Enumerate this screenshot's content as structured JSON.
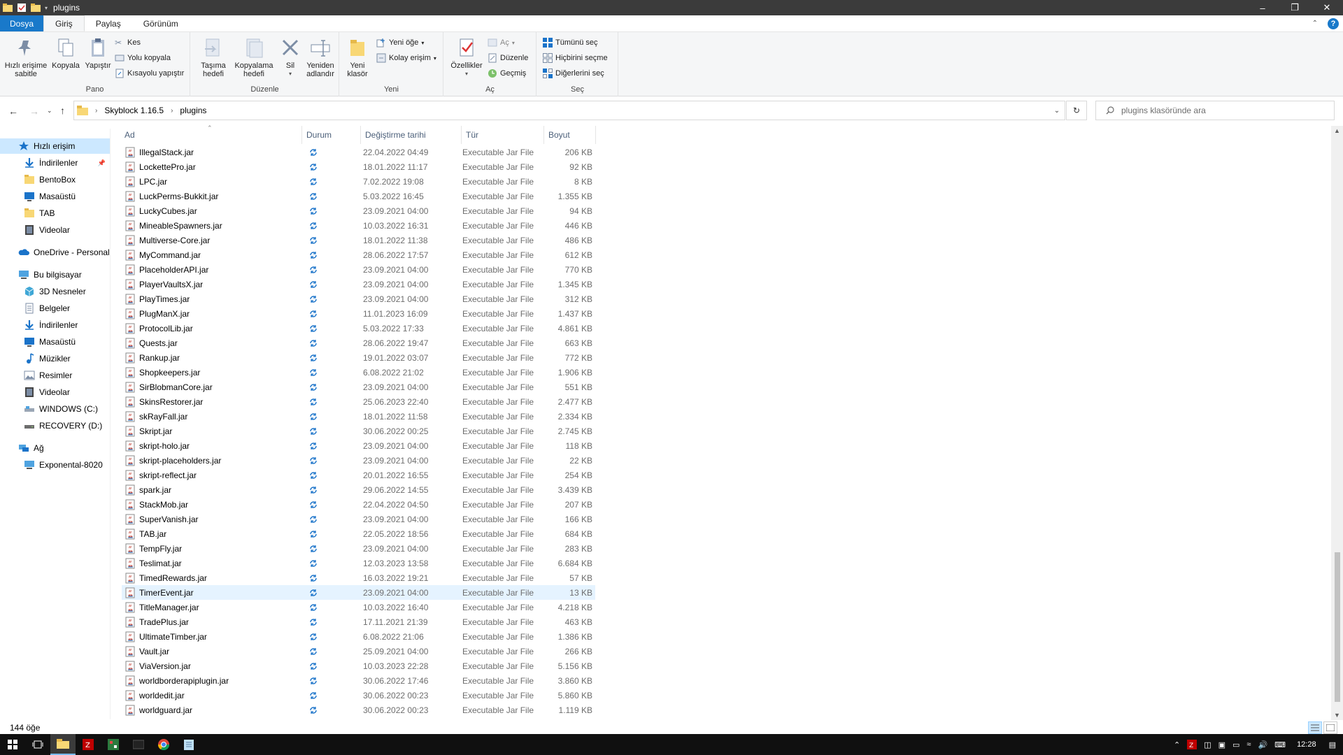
{
  "window": {
    "title": "plugins"
  },
  "ribbon_tabs": [
    "Dosya",
    "Giriş",
    "Paylaş",
    "Görünüm"
  ],
  "ribbon": {
    "pano": {
      "label": "Pano",
      "pin": "Hızlı erişime sabitle",
      "copy": "Kopyala",
      "paste": "Yapıştır",
      "cut": "Kes",
      "copy_path": "Yolu kopyala",
      "paste_shortcut": "Kısayolu yapıştır"
    },
    "duzenle": {
      "label": "Düzenle",
      "move_to": "Taşıma hedefi",
      "copy_to": "Kopyalama hedefi",
      "delete": "Sil",
      "rename": "Yeniden adlandır"
    },
    "yeni": {
      "label": "Yeni",
      "new_folder": "Yeni klasör",
      "new_item": "Yeni öğe",
      "easy_access": "Kolay erişim"
    },
    "ac": {
      "label": "Aç",
      "properties": "Özellikler",
      "open": "Aç",
      "edit": "Düzenle",
      "history": "Geçmiş"
    },
    "sec": {
      "label": "Seç",
      "select_all": "Tümünü seç",
      "select_none": "Hiçbirini seçme",
      "invert": "Diğerlerini seç"
    }
  },
  "address": {
    "crumbs": [
      "Skyblock 1.16.5",
      "plugins"
    ],
    "search_placeholder": "plugins klasöründe ara"
  },
  "nav": {
    "quick_access": "Hızlı erişim",
    "quick_items": [
      "İndirilenler",
      "BentoBox",
      "Masaüstü",
      "TAB",
      "Videolar"
    ],
    "onedrive": "OneDrive - Personal",
    "this_pc": "Bu bilgisayar",
    "pc_items": [
      "3D Nesneler",
      "Belgeler",
      "İndirilenler",
      "Masaüstü",
      "Müzikler",
      "Resimler",
      "Videolar",
      "WINDOWS (C:)",
      "RECOVERY (D:)"
    ],
    "network": "Ağ",
    "network_items": [
      "Exponental-8020"
    ]
  },
  "columns": {
    "name": "Ad",
    "status": "Durum",
    "date": "Değiştirme tarihi",
    "type": "Tür",
    "size": "Boyut"
  },
  "file_type": "Executable Jar File",
  "files": [
    {
      "name": "IllegalStack.jar",
      "date": "22.04.2022 04:49",
      "size": "206 KB"
    },
    {
      "name": "LockettePro.jar",
      "date": "18.01.2022 11:17",
      "size": "92 KB"
    },
    {
      "name": "LPC.jar",
      "date": "7.02.2022 19:08",
      "size": "8 KB"
    },
    {
      "name": "LuckPerms-Bukkit.jar",
      "date": "5.03.2022 16:45",
      "size": "1.355 KB"
    },
    {
      "name": "LuckyCubes.jar",
      "date": "23.09.2021 04:00",
      "size": "94 KB"
    },
    {
      "name": "MineableSpawners.jar",
      "date": "10.03.2022 16:31",
      "size": "446 KB"
    },
    {
      "name": "Multiverse-Core.jar",
      "date": "18.01.2022 11:38",
      "size": "486 KB"
    },
    {
      "name": "MyCommand.jar",
      "date": "28.06.2022 17:57",
      "size": "612 KB"
    },
    {
      "name": "PlaceholderAPI.jar",
      "date": "23.09.2021 04:00",
      "size": "770 KB"
    },
    {
      "name": "PlayerVaultsX.jar",
      "date": "23.09.2021 04:00",
      "size": "1.345 KB"
    },
    {
      "name": "PlayTimes.jar",
      "date": "23.09.2021 04:00",
      "size": "312 KB"
    },
    {
      "name": "PlugManX.jar",
      "date": "11.01.2023 16:09",
      "size": "1.437 KB"
    },
    {
      "name": "ProtocolLib.jar",
      "date": "5.03.2022 17:33",
      "size": "4.861 KB"
    },
    {
      "name": "Quests.jar",
      "date": "28.06.2022 19:47",
      "size": "663 KB"
    },
    {
      "name": "Rankup.jar",
      "date": "19.01.2022 03:07",
      "size": "772 KB"
    },
    {
      "name": "Shopkeepers.jar",
      "date": "6.08.2022 21:02",
      "size": "1.906 KB"
    },
    {
      "name": "SirBlobmanCore.jar",
      "date": "23.09.2021 04:00",
      "size": "551 KB"
    },
    {
      "name": "SkinsRestorer.jar",
      "date": "25.06.2023 22:40",
      "size": "2.477 KB"
    },
    {
      "name": "skRayFall.jar",
      "date": "18.01.2022 11:58",
      "size": "2.334 KB"
    },
    {
      "name": "Skript.jar",
      "date": "30.06.2022 00:25",
      "size": "2.745 KB"
    },
    {
      "name": "skript-holo.jar",
      "date": "23.09.2021 04:00",
      "size": "118 KB"
    },
    {
      "name": "skript-placeholders.jar",
      "date": "23.09.2021 04:00",
      "size": "22 KB"
    },
    {
      "name": "skript-reflect.jar",
      "date": "20.01.2022 16:55",
      "size": "254 KB"
    },
    {
      "name": "spark.jar",
      "date": "29.06.2022 14:55",
      "size": "3.439 KB"
    },
    {
      "name": "StackMob.jar",
      "date": "22.04.2022 04:50",
      "size": "207 KB"
    },
    {
      "name": "SuperVanish.jar",
      "date": "23.09.2021 04:00",
      "size": "166 KB"
    },
    {
      "name": "TAB.jar",
      "date": "22.05.2022 18:56",
      "size": "684 KB"
    },
    {
      "name": "TempFly.jar",
      "date": "23.09.2021 04:00",
      "size": "283 KB"
    },
    {
      "name": "Teslimat.jar",
      "date": "12.03.2023 13:58",
      "size": "6.684 KB"
    },
    {
      "name": "TimedRewards.jar",
      "date": "16.03.2022 19:21",
      "size": "57 KB"
    },
    {
      "name": "TimerEvent.jar",
      "date": "23.09.2021 04:00",
      "size": "13 KB",
      "highlighted": true
    },
    {
      "name": "TitleManager.jar",
      "date": "10.03.2022 16:40",
      "size": "4.218 KB"
    },
    {
      "name": "TradePlus.jar",
      "date": "17.11.2021 21:39",
      "size": "463 KB"
    },
    {
      "name": "UltimateTimber.jar",
      "date": "6.08.2022 21:06",
      "size": "1.386 KB"
    },
    {
      "name": "Vault.jar",
      "date": "25.09.2021 04:00",
      "size": "266 KB"
    },
    {
      "name": "ViaVersion.jar",
      "date": "10.03.2023 22:28",
      "size": "5.156 KB"
    },
    {
      "name": "worldborderapiplugin.jar",
      "date": "30.06.2022 17:46",
      "size": "3.860 KB"
    },
    {
      "name": "worldedit.jar",
      "date": "30.06.2022 00:23",
      "size": "5.860 KB"
    },
    {
      "name": "worldguard.jar",
      "date": "30.06.2022 00:23",
      "size": "1.119 KB"
    }
  ],
  "status": {
    "item_count": "144 öğe"
  },
  "taskbar": {
    "clock": "12:28"
  },
  "colors": {
    "accent": "#1979ca",
    "selection": "#cce8ff",
    "sync": "#1a73c9"
  }
}
